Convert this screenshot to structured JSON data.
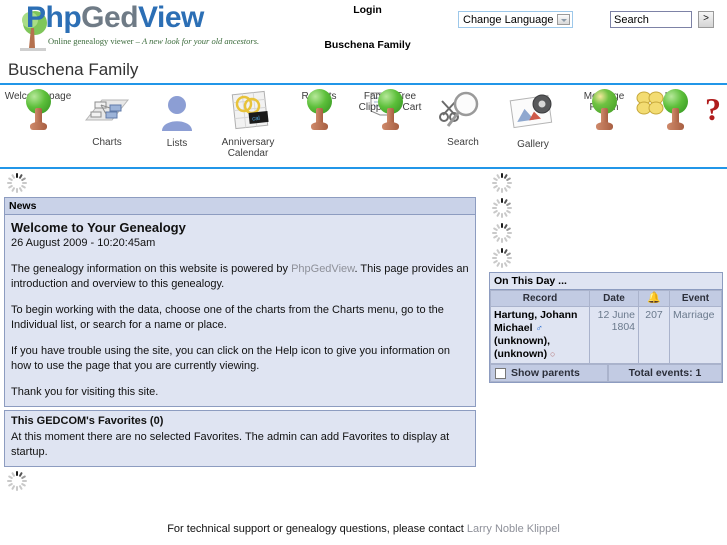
{
  "header": {
    "logo_php": "Php",
    "logo_ged": "Ged",
    "logo_view": "View",
    "tagline_plain": "Online genealogy viewer – ",
    "tagline_italic": "A new look for your old ancestors.",
    "login_label": "Login",
    "gedcom_title": "Buschena Family",
    "language_selected": "Change Language",
    "search_value": "Search",
    "search_button_label": ">"
  },
  "page": {
    "title": "Buschena Family"
  },
  "toolbar": {
    "items": [
      {
        "label": "Welcome page",
        "icon": "tree-icon"
      },
      {
        "label": "Charts",
        "icon": "charts-icon"
      },
      {
        "label": "Lists",
        "icon": "person-icon"
      },
      {
        "label": "Anniversary\nCalendar",
        "icon": "calendar-icon"
      },
      {
        "label": "Reports",
        "icon": "reports-icon"
      },
      {
        "label": "Family Tree\nClippings Cart",
        "icon": "scissors-tree-icon"
      },
      {
        "label": "Search",
        "icon": "magnifier-icon"
      },
      {
        "label": "Gallery",
        "icon": "gallery-icon"
      },
      {
        "label": "Message\nForum",
        "icon": "message-tree-icon"
      },
      {
        "label": "Help",
        "icon": "question-tree-icon"
      }
    ]
  },
  "news": {
    "block_title": "News",
    "headline": "Welcome to Your Genealogy",
    "timestamp": "26 August 2009 - 10:20:45am",
    "para1_before": "The genealogy information on this website is powered by ",
    "para1_link": "PhpGedView",
    "para1_after": ". This page provides an introduction and overview to this genealogy.",
    "para2": "To begin working with the data, choose one of the charts from the Charts menu, go to the Individual list, or search for a name or place.",
    "para3": "If you have trouble using the site, you can click on the Help icon to give you information on how to use the page that you are currently viewing.",
    "para4": "Thank you for visiting this site."
  },
  "favorites": {
    "title": "This GEDCOM's Favorites  (0)",
    "body": "At this moment there are no selected Favorites. The admin can add Favorites to display at startup."
  },
  "on_this_day": {
    "title": "On This Day ...",
    "columns": [
      "Record",
      "Date",
      "bell-icon",
      "Event"
    ],
    "rows": [
      {
        "record_line1": "Hartung, Johann",
        "record_line2": "Michael",
        "record_sex1": "♂",
        "record_line3": "(unknown),",
        "record_line4": "(unknown)",
        "record_sex2": "○",
        "date": "12 June 1804",
        "number": "207",
        "event": "Marriage"
      }
    ],
    "show_parents_label": "Show parents",
    "total_label": "Total events: 1"
  },
  "footer": {
    "text_before": "For technical support or genealogy questions, please contact ",
    "contact_link": "Larry Noble Klippel"
  }
}
